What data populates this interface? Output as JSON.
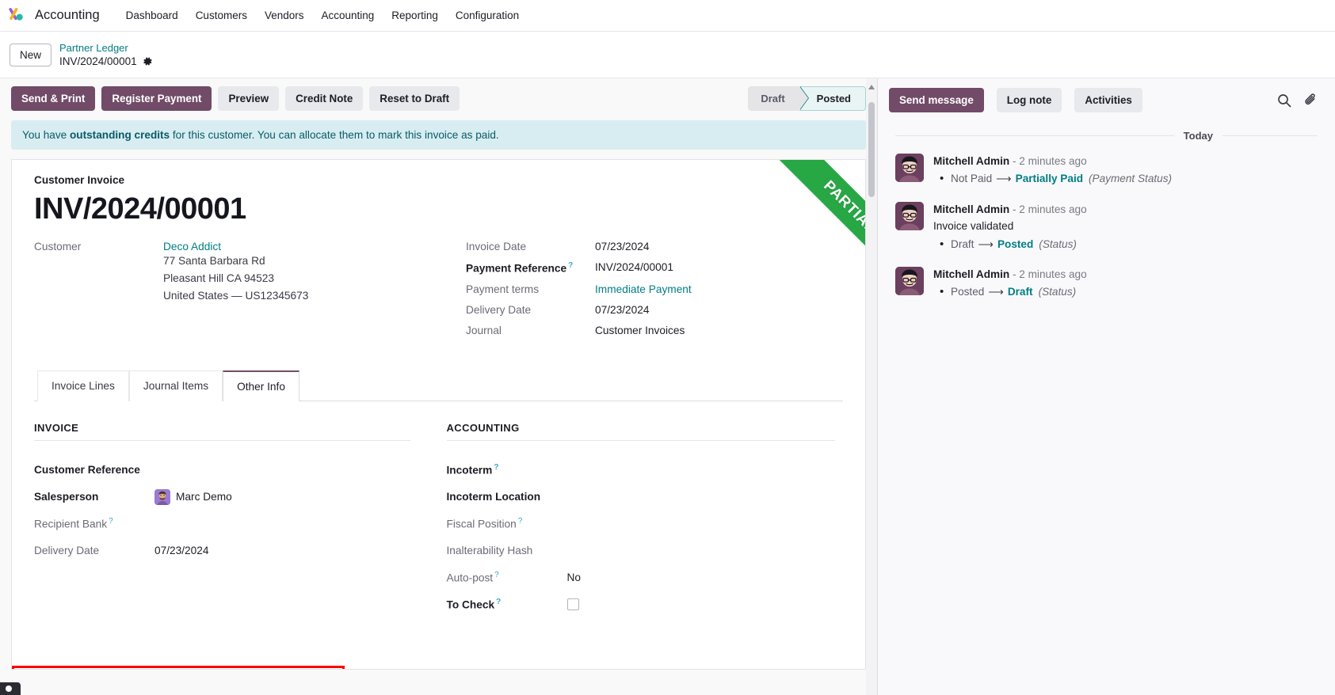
{
  "navbar": {
    "brand": "Accounting",
    "menus": [
      "Dashboard",
      "Customers",
      "Vendors",
      "Accounting",
      "Reporting",
      "Configuration"
    ]
  },
  "breadcrumb": {
    "new_label": "New",
    "parent": "Partner Ledger",
    "current": "INV/2024/00001",
    "gear_icon": "gear-icon"
  },
  "control_panel": {
    "buttons": [
      {
        "label": "Send & Print",
        "style": "primary"
      },
      {
        "label": "Register Payment",
        "style": "primary"
      },
      {
        "label": "Preview",
        "style": "secondary"
      },
      {
        "label": "Credit Note",
        "style": "secondary"
      },
      {
        "label": "Reset to Draft",
        "style": "secondary"
      }
    ],
    "statusbar": [
      {
        "label": "Draft",
        "active": false
      },
      {
        "label": "Posted",
        "active": true
      }
    ]
  },
  "alert": {
    "prefix": "You have ",
    "strong": "outstanding credits",
    "suffix": " for this customer. You can allocate them to mark this invoice as paid."
  },
  "sheet": {
    "ribbon": "PARTIAL",
    "doc_type": "Customer Invoice",
    "doc_title": "INV/2024/00001",
    "customer_label": "Customer",
    "customer_name": "Deco Addict",
    "customer_address": [
      "77 Santa Barbara Rd",
      "Pleasant Hill CA 94523",
      "United States — US12345673"
    ],
    "fields_right": [
      {
        "label": "Invoice Date",
        "value": "07/23/2024",
        "bold": false,
        "help": false,
        "link": false
      },
      {
        "label": "Payment Reference",
        "value": "INV/2024/00001",
        "bold": true,
        "help": true,
        "link": false
      },
      {
        "label": "Payment terms",
        "value": "Immediate Payment",
        "bold": false,
        "help": false,
        "link": true
      },
      {
        "label": "Delivery Date",
        "value": "07/23/2024",
        "bold": false,
        "help": false,
        "link": false
      },
      {
        "label": "Journal",
        "value": "Customer Invoices",
        "bold": false,
        "help": false,
        "link": false
      }
    ]
  },
  "notebook": {
    "tabs": [
      {
        "label": "Invoice Lines",
        "active": false
      },
      {
        "label": "Journal Items",
        "active": false
      },
      {
        "label": "Other Info",
        "active": true
      }
    ],
    "invoice_group": {
      "title": "INVOICE",
      "rows": [
        {
          "label": "Customer Reference",
          "value": "",
          "bold": true,
          "help": false,
          "avatar": false,
          "checkbox": false
        },
        {
          "label": "Salesperson",
          "value": "Marc Demo",
          "bold": true,
          "help": false,
          "avatar": true,
          "checkbox": false
        },
        {
          "label": "Recipient Bank",
          "value": "",
          "bold": false,
          "help": true,
          "avatar": false,
          "checkbox": false
        },
        {
          "label": "Delivery Date",
          "value": "07/23/2024",
          "bold": false,
          "help": false,
          "avatar": false,
          "checkbox": false
        }
      ]
    },
    "accounting_group": {
      "title": "ACCOUNTING",
      "rows": [
        {
          "label": "Incoterm",
          "value": "",
          "bold": true,
          "help": true,
          "avatar": false,
          "checkbox": false
        },
        {
          "label": "Incoterm Location",
          "value": "",
          "bold": true,
          "help": false,
          "avatar": false,
          "checkbox": false
        },
        {
          "label": "Fiscal Position",
          "value": "",
          "bold": false,
          "help": true,
          "avatar": false,
          "checkbox": false
        },
        {
          "label": "Inalterability Hash",
          "value": "",
          "bold": false,
          "help": false,
          "avatar": false,
          "checkbox": false
        },
        {
          "label": "Auto-post",
          "value": "No",
          "bold": false,
          "help": true,
          "avatar": false,
          "checkbox": false
        },
        {
          "label": "To Check",
          "value": "",
          "bold": true,
          "help": true,
          "avatar": false,
          "checkbox": true
        }
      ]
    }
  },
  "chatter": {
    "buttons": [
      {
        "label": "Send message",
        "style": "primary"
      },
      {
        "label": "Log note",
        "style": "secondary"
      },
      {
        "label": "Activities",
        "style": "secondary"
      }
    ],
    "icons": [
      "search-icon",
      "paperclip-icon"
    ],
    "day_label": "Today",
    "messages": [
      {
        "author": "Mitchell Admin",
        "time": "- 2 minutes ago",
        "text": "",
        "tracking": [
          {
            "old": "Not Paid",
            "arrow": "⟶",
            "new": "Partially Paid",
            "field": "(Payment Status)"
          }
        ]
      },
      {
        "author": "Mitchell Admin",
        "time": "- 2 minutes ago",
        "text": "Invoice validated",
        "tracking": [
          {
            "old": "Draft",
            "arrow": "⟶",
            "new": "Posted",
            "field": "(Status)"
          }
        ]
      },
      {
        "author": "Mitchell Admin",
        "time": "- 2 minutes ago",
        "text": "",
        "tracking": [
          {
            "old": "Posted",
            "arrow": "⟶",
            "new": "Draft",
            "field": "(Status)"
          }
        ]
      }
    ]
  },
  "colors": {
    "primary": "#714b67",
    "link": "#017e84",
    "alert_bg": "#d7edf1",
    "ribbon_green": "#28a745",
    "highlight_red": "#ff0000"
  }
}
